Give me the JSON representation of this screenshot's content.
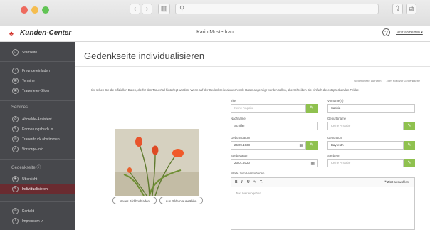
{
  "browser": {
    "back_icon": "‹",
    "forward_icon": "›",
    "sidebar_icon": "▥",
    "search_icon": "⚲",
    "share_icon": "⇪",
    "tabs_icon": "⧉"
  },
  "header": {
    "logo_icon": "♣",
    "app_title": "Kunden-Center",
    "user_name": "Karin Musterfrau",
    "help_icon": "?",
    "logout_label": "Jetzt abmelden ▾"
  },
  "sidebar": {
    "items_top": [
      {
        "icon": "⌂",
        "label": "Startseite"
      },
      {
        "icon": "+",
        "label": "Freunde einladen"
      },
      {
        "icon": "▦",
        "label": "Termine"
      },
      {
        "icon": "▣",
        "label": "Trauerfeier-Bilder"
      }
    ],
    "services_title": "Services",
    "services": [
      {
        "icon": "✆",
        "label": "Abmelde-Assistent"
      },
      {
        "icon": "✎",
        "label": "Erinnerungsbuch ⇗"
      },
      {
        "icon": "✉",
        "label": "Trauerdruck abstimmen"
      },
      {
        "icon": "✓",
        "label": "Vorsorge-Info"
      }
    ],
    "memorial_title": "Gedenkseite ⓘ",
    "memorial": [
      {
        "icon": "◉",
        "label": "Übersicht"
      },
      {
        "icon": "✎",
        "label": "Individualisieren"
      }
    ],
    "bottom": [
      {
        "icon": "✉",
        "label": "Kontakt"
      },
      {
        "icon": "i",
        "label": "Impressum ⇗"
      }
    ]
  },
  "main": {
    "title": "Gedenkseite individualisieren",
    "link_visit": "Gedenkseite aufrufen",
    "link_zoom": "Zum Foto zur Gedenkseite",
    "intro": "Hier sehen Sie die offiziellen Daten, die für den Trauerfall hinterlegt wurden. Wenn auf der Gedenkseite abweichende Daten angezeigt werden sollen, überschreiben Sie einfach die entsprechenden Felder.",
    "upload_btn": "Neues Bild hochladen",
    "pick_btn": "Aus Bildern auswählen",
    "form": {
      "titel_label": "Titel",
      "titel_value": "Keine Angabe",
      "vorname_label": "Vorname(n)",
      "vorname_value": "Saskia",
      "nachname_label": "Nachname",
      "nachname_value": "Schiffer",
      "geburtsname_label": "Geburtsname",
      "geburtsname_value": "Keine Angabe",
      "geburtsdatum_label": "Geburtsdatum",
      "geburtsdatum_value": "26.09.1938",
      "geburtsort_label": "Geburtsort",
      "geburtsort_value": "Bayreuth",
      "sterbedatum_label": "Sterbedatum",
      "sterbedatum_value": "23.01.2020",
      "sterbeort_label": "Sterbeort",
      "sterbeort_value": "Keine Angabe",
      "green_btn_icon": "✎",
      "calendar_icon": "▦",
      "editor_label": "Worte zum Verstorbenen",
      "editor_placeholder": "Text hier eingeben...",
      "quote_btn": "❞ Zitat auswählen",
      "tools": [
        "B",
        "I",
        "U",
        "✎",
        "T̶"
      ]
    }
  }
}
